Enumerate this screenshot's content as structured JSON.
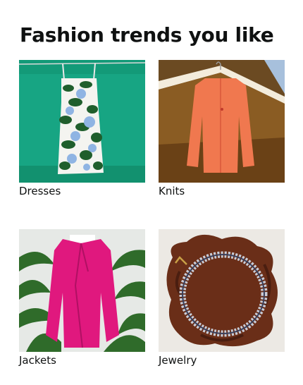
{
  "card": {
    "title": "Fashion trends you like",
    "tiles": [
      {
        "label": "Dresses",
        "image": "floral-dress-photo"
      },
      {
        "label": "Knits",
        "image": "orange-cardigan-photo"
      },
      {
        "label": "Jackets",
        "image": "pink-blazer-photo"
      },
      {
        "label": "Jewelry",
        "image": "crystal-necklace-photo"
      }
    ]
  },
  "colors": {
    "text": "#0f1111",
    "background": "#ffffff"
  }
}
